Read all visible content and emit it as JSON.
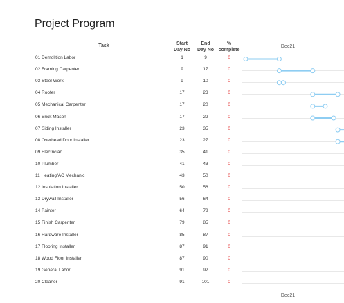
{
  "title": "Project Program",
  "headers": {
    "task": "Task",
    "start": [
      "Start",
      "Day No"
    ],
    "end": [
      "End",
      "Day No"
    ],
    "pct": [
      "%",
      "complete"
    ]
  },
  "month_label": "Dec21",
  "colors": {
    "bar": "#8ecdf2",
    "marker_stroke": "#8ecdf2",
    "percent": "#e02020",
    "grid": "#e8e8e8"
  },
  "chart_data": {
    "type": "gantt",
    "title": "Project Program",
    "x_axis_label": "Dec21",
    "tasks": [
      {
        "name": "01 Demolition Labor",
        "start": 1,
        "end": 9,
        "complete": 0
      },
      {
        "name": "02 Framing Carpenter",
        "start": 9,
        "end": 17,
        "complete": 0
      },
      {
        "name": "03 Steel Work",
        "start": 9,
        "end": 10,
        "complete": 0
      },
      {
        "name": "04 Roofer",
        "start": 17,
        "end": 23,
        "complete": 0
      },
      {
        "name": "05 Mechanical Carpenter",
        "start": 17,
        "end": 20,
        "complete": 0
      },
      {
        "name": "06 Brick Mason",
        "start": 17,
        "end": 22,
        "complete": 0
      },
      {
        "name": "07 Siding Installer",
        "start": 23,
        "end": 35,
        "complete": 0
      },
      {
        "name": "08 Overhead Door Installer",
        "start": 23,
        "end": 27,
        "complete": 0
      },
      {
        "name": "09 Electrician",
        "start": 35,
        "end": 41,
        "complete": 0
      },
      {
        "name": "10 Plumber",
        "start": 41,
        "end": 43,
        "complete": 0
      },
      {
        "name": "11 Heating/AC Mechanic",
        "start": 43,
        "end": 50,
        "complete": 0
      },
      {
        "name": "12 Insulation Installer",
        "start": 50,
        "end": 56,
        "complete": 0
      },
      {
        "name": "13 Drywall Installer",
        "start": 56,
        "end": 64,
        "complete": 0
      },
      {
        "name": "14 Painter",
        "start": 64,
        "end": 79,
        "complete": 0
      },
      {
        "name": "15 Finish Carpenter",
        "start": 79,
        "end": 85,
        "complete": 0
      },
      {
        "name": "16 Hardware Installer",
        "start": 85,
        "end": 87,
        "complete": 0
      },
      {
        "name": "17 Flooring Installer",
        "start": 87,
        "end": 91,
        "complete": 0
      },
      {
        "name": "18 Wood Floor Installer",
        "start": 87,
        "end": 90,
        "complete": 0
      },
      {
        "name": "19 General Labor",
        "start": 91,
        "end": 92,
        "complete": 0
      },
      {
        "name": "20 Cleaner",
        "start": 91,
        "end": 101,
        "complete": 0
      }
    ]
  }
}
